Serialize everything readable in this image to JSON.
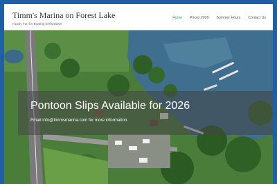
{
  "site": {
    "title": "Timm's Marina on Forest Lake",
    "tagline": "Family Fun for Boating Enthusiasts"
  },
  "nav": {
    "items": [
      {
        "label": "Home",
        "active": true
      },
      {
        "label": "Prices 2026",
        "active": false
      },
      {
        "label": "Summer Hours",
        "active": false
      },
      {
        "label": "Contact Us",
        "active": false
      }
    ]
  },
  "hero": {
    "title": "Pontoon Slips Available for 2026",
    "subtitle": "Email info@timmsmarina.com for more information."
  },
  "colors": {
    "background": "#1f5fa6",
    "nav_active": "#2e9e5b",
    "nav_text": "#555555",
    "lake": "#3f6e8f",
    "greenery": "#3d7a32"
  }
}
